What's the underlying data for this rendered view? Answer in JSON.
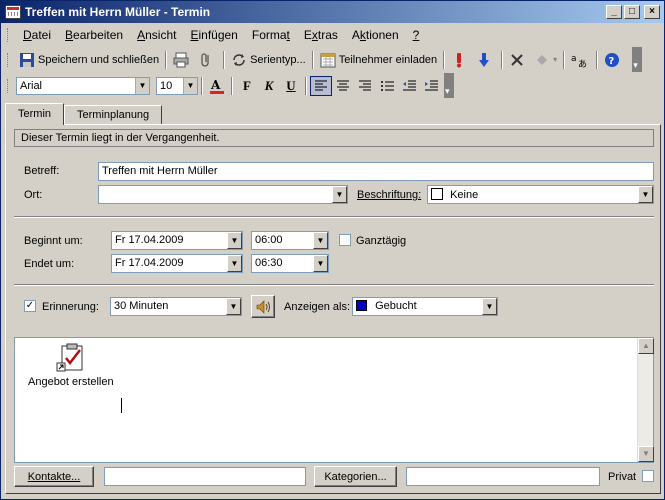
{
  "window": {
    "title": "Treffen mit Herrn Müller - Termin"
  },
  "menu": [
    {
      "pre": "",
      "u": "D",
      "post": "atei"
    },
    {
      "pre": "",
      "u": "B",
      "post": "earbeiten"
    },
    {
      "pre": "",
      "u": "A",
      "post": "nsicht"
    },
    {
      "pre": "",
      "u": "E",
      "post": "infügen"
    },
    {
      "pre": "Forma",
      "u": "t",
      "post": ""
    },
    {
      "pre": "E",
      "u": "x",
      "post": "tras"
    },
    {
      "pre": "A",
      "u": "k",
      "post": "tionen"
    },
    {
      "pre": "",
      "u": "?",
      "post": ""
    }
  ],
  "toolbar": {
    "save_label": "Speichern und schließen",
    "recurrence_label": "Serientyp...",
    "invite_label": "Teilnehmer einladen"
  },
  "format": {
    "font": "Arial",
    "size": "10"
  },
  "tabs": {
    "appointment": "Termin",
    "scheduling": "Terminplanung"
  },
  "form": {
    "info": "Dieser Termin liegt in der Vergangenheit.",
    "subject_label": "Betreff:",
    "subject": "Treffen mit Herrn Müller",
    "location_label": "Ort:",
    "location": "",
    "label_label": "Beschriftung:",
    "label_value": "Keine",
    "start_label": "Beginnt um:",
    "start_date": "Fr 17.04.2009",
    "start_time": "06:00",
    "allday_label": "Ganztägig",
    "end_label": "Endet um:",
    "end_date": "Fr 17.04.2009",
    "end_time": "06:30",
    "reminder_label": "Erinnerung:",
    "reminder_value": "30 Minuten",
    "showas_label": "Anzeigen als:",
    "showas_value": "Gebucht",
    "showas_color": "#0000c8"
  },
  "notes": {
    "attachment_label": "Angebot erstellen"
  },
  "footer": {
    "contacts_label": "Kontakte...",
    "contacts_value": "",
    "categories_label": "Kategorien...",
    "categories_value": "",
    "private_label": "Privat"
  }
}
